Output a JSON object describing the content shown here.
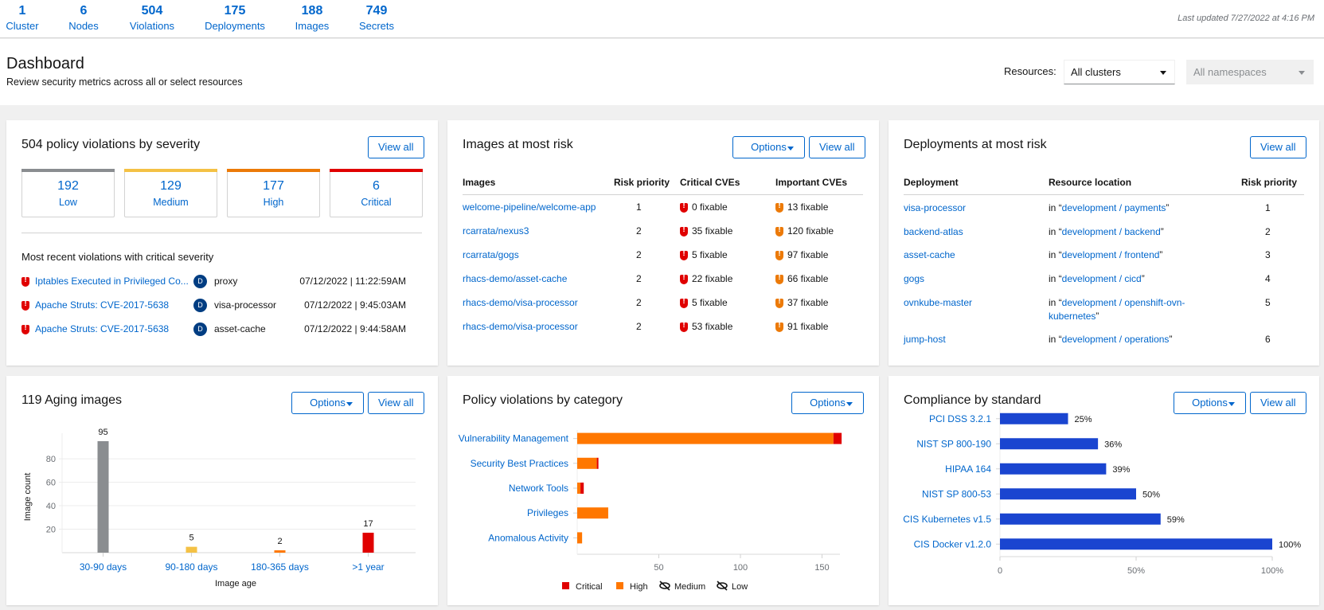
{
  "summary": [
    {
      "count": "1",
      "label": "Cluster"
    },
    {
      "count": "6",
      "label": "Nodes"
    },
    {
      "count": "504",
      "label": "Violations"
    },
    {
      "count": "175",
      "label": "Deployments"
    },
    {
      "count": "188",
      "label": "Images"
    },
    {
      "count": "749",
      "label": "Secrets"
    }
  ],
  "last_updated": "Last updated 7/27/2022 at 4:16 PM",
  "header": {
    "title": "Dashboard",
    "subtitle": "Review security metrics across all or select resources",
    "resources_label": "Resources:",
    "cluster_select": "All clusters",
    "namespace_select": "All namespaces"
  },
  "buttons": {
    "view_all": "View all",
    "options": "Options"
  },
  "colors": {
    "low": "#8a8d90",
    "medium": "#f4c145",
    "high": "#ec7a08",
    "critical": "#c9190b",
    "critical_bright": "#e00000",
    "high_bright": "#ff7700",
    "link": "#0066cc",
    "compliance": "#1a45d0"
  },
  "violations": {
    "title": "504 policy violations by severity",
    "tiles": [
      {
        "count": "192",
        "label": "Low"
      },
      {
        "count": "129",
        "label": "Medium"
      },
      {
        "count": "177",
        "label": "High"
      },
      {
        "count": "6",
        "label": "Critical"
      }
    ],
    "recent_title": "Most recent violations with critical severity",
    "recent": [
      {
        "policy": "Iptables Executed in Privileged Co...",
        "badge": "D",
        "deployment": "proxy",
        "time": "07/12/2022 | 11:22:59AM"
      },
      {
        "policy": "Apache Struts: CVE-2017-5638",
        "badge": "D",
        "deployment": "visa-processor",
        "time": "07/12/2022 | 9:45:03AM"
      },
      {
        "policy": "Apache Struts: CVE-2017-5638",
        "badge": "D",
        "deployment": "asset-cache",
        "time": "07/12/2022 | 9:44:58AM"
      }
    ]
  },
  "images_at_risk": {
    "title": "Images at most risk",
    "columns": [
      "Images",
      "Risk priority",
      "Critical CVEs",
      "Important CVEs"
    ],
    "rows": [
      {
        "image": "welcome-pipeline/welcome-app",
        "priority": "1",
        "critical": "0 fixable",
        "important": "13 fixable"
      },
      {
        "image": "rcarrata/nexus3",
        "priority": "2",
        "critical": "35 fixable",
        "important": "120 fixable"
      },
      {
        "image": "rcarrata/gogs",
        "priority": "2",
        "critical": "5 fixable",
        "important": "97 fixable"
      },
      {
        "image": "rhacs-demo/asset-cache",
        "priority": "2",
        "critical": "22 fixable",
        "important": "66 fixable"
      },
      {
        "image": "rhacs-demo/visa-processor",
        "priority": "2",
        "critical": "5 fixable",
        "important": "37 fixable"
      },
      {
        "image": "rhacs-demo/visa-processor",
        "priority": "2",
        "critical": "53 fixable",
        "important": "91 fixable"
      }
    ]
  },
  "deployments_at_risk": {
    "title": "Deployments at most risk",
    "columns": [
      "Deployment",
      "Resource location",
      "Risk priority"
    ],
    "rows": [
      {
        "deployment": "visa-processor",
        "prefix": "in “",
        "location": "development / payments",
        "suffix": "”",
        "priority": "1"
      },
      {
        "deployment": "backend-atlas",
        "prefix": "in “",
        "location": "development / backend",
        "suffix": "”",
        "priority": "2"
      },
      {
        "deployment": "asset-cache",
        "prefix": "in “",
        "location": "development / frontend",
        "suffix": "”",
        "priority": "3"
      },
      {
        "deployment": "gogs",
        "prefix": "in “",
        "location": "development / cicd",
        "suffix": "”",
        "priority": "4"
      },
      {
        "deployment": "ovnkube-master",
        "prefix": "in “",
        "location": "development / openshift-ovn-kubernetes",
        "suffix": "”",
        "priority": "5"
      },
      {
        "deployment": "jump-host",
        "prefix": "in “",
        "location": "development / operations",
        "suffix": "”",
        "priority": "6"
      }
    ]
  },
  "chart_data": [
    {
      "id": "aging",
      "type": "bar",
      "title": "119 Aging images",
      "categories": [
        "30-90 days",
        "90-180 days",
        "180-365 days",
        ">1 year"
      ],
      "values": [
        95,
        5,
        2,
        17
      ],
      "colors": [
        "#8a8d90",
        "#f4c145",
        "#ff7700",
        "#e00000"
      ],
      "xlabel": "Image age",
      "ylabel": "Image count",
      "yticks": [
        20,
        40,
        60,
        80
      ],
      "ylim": [
        0,
        95
      ],
      "grid": true
    },
    {
      "id": "category",
      "type": "bar",
      "orientation": "horizontal",
      "stacked": true,
      "title": "Policy violations by category",
      "categories": [
        "Vulnerability Management",
        "Security Best Practices",
        "Network Tools",
        "Privileges",
        "Anomalous Activity"
      ],
      "series": [
        {
          "name": "High",
          "color": "#ff7700",
          "values": [
            157,
            12,
            2,
            19,
            3
          ]
        },
        {
          "name": "Critical",
          "color": "#e00000",
          "values": [
            5,
            1,
            2,
            0,
            0
          ]
        }
      ],
      "xticks": [
        50,
        100,
        150
      ],
      "xlim": [
        0,
        162
      ],
      "legend": [
        {
          "name": "Critical",
          "color": "#e00000",
          "hidden": false
        },
        {
          "name": "High",
          "color": "#ff7700",
          "hidden": false
        },
        {
          "name": "Medium",
          "hidden": true
        },
        {
          "name": "Low",
          "hidden": true
        }
      ],
      "legend_position": "bottom"
    },
    {
      "id": "compliance",
      "type": "bar",
      "orientation": "horizontal",
      "title": "Compliance by standard",
      "categories": [
        "PCI DSS 3.2.1",
        "NIST SP 800-190",
        "HIPAA 164",
        "NIST SP 800-53",
        "CIS Kubernetes v1.5",
        "CIS Docker v1.2.0"
      ],
      "values": [
        25,
        36,
        39,
        50,
        59,
        100
      ],
      "labels": [
        "25%",
        "36%",
        "39%",
        "50%",
        "59%",
        "100%"
      ],
      "xticks": [
        "0",
        "50%",
        "100%"
      ],
      "xlim": [
        0,
        100
      ],
      "color": "#1a45d0"
    }
  ]
}
